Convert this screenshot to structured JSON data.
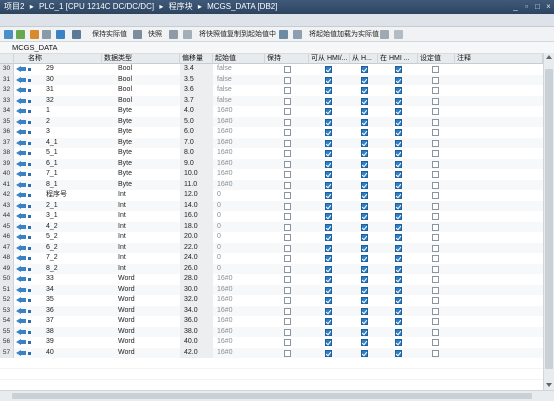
{
  "breadcrumb": [
    "项目2",
    "PLC_1 [CPU 1214C DC/DC/DC]",
    "程序块",
    "MCGS_DATA [DB2]"
  ],
  "breadcrumb_separator": "▸",
  "window_controls": [
    "_",
    "▫",
    "□",
    "×"
  ],
  "toolbar": {
    "keep_actual": "保持实际值",
    "snapshot": "快照",
    "copy_snapshot": "将快照值复制到起始值中",
    "load_start": "将起始值加载为实际值"
  },
  "block_name": "MCGS_DATA",
  "columns": [
    "名称",
    "数据类型",
    "偏移量",
    "起始值",
    "保持",
    "可从 HMI/...",
    "从 H...",
    "在 HMI ...",
    "设定值",
    "注释"
  ],
  "rows": [
    {
      "n": "30",
      "name": "29",
      "type": "Bool",
      "offset": "3.4",
      "start": "false",
      "hmi1": true,
      "hmi2": true,
      "hmi3": true
    },
    {
      "n": "31",
      "name": "30",
      "type": "Bool",
      "offset": "3.5",
      "start": "false",
      "hmi1": true,
      "hmi2": true,
      "hmi3": true
    },
    {
      "n": "32",
      "name": "31",
      "type": "Bool",
      "offset": "3.6",
      "start": "false",
      "hmi1": true,
      "hmi2": true,
      "hmi3": true
    },
    {
      "n": "33",
      "name": "32",
      "type": "Bool",
      "offset": "3.7",
      "start": "false",
      "hmi1": true,
      "hmi2": true,
      "hmi3": true
    },
    {
      "n": "34",
      "name": "1",
      "type": "Byte",
      "offset": "4.0",
      "start": "16#0",
      "hmi1": true,
      "hmi2": true,
      "hmi3": true
    },
    {
      "n": "35",
      "name": "2",
      "type": "Byte",
      "offset": "5.0",
      "start": "16#0",
      "hmi1": true,
      "hmi2": true,
      "hmi3": true
    },
    {
      "n": "36",
      "name": "3",
      "type": "Byte",
      "offset": "6.0",
      "start": "16#0",
      "hmi1": true,
      "hmi2": true,
      "hmi3": true
    },
    {
      "n": "37",
      "name": "4_1",
      "type": "Byte",
      "offset": "7.0",
      "start": "16#0",
      "hmi1": true,
      "hmi2": true,
      "hmi3": true
    },
    {
      "n": "38",
      "name": "5_1",
      "type": "Byte",
      "offset": "8.0",
      "start": "16#0",
      "hmi1": true,
      "hmi2": true,
      "hmi3": true
    },
    {
      "n": "39",
      "name": "6_1",
      "type": "Byte",
      "offset": "9.0",
      "start": "16#0",
      "hmi1": true,
      "hmi2": true,
      "hmi3": true
    },
    {
      "n": "40",
      "name": "7_1",
      "type": "Byte",
      "offset": "10.0",
      "start": "16#0",
      "hmi1": true,
      "hmi2": true,
      "hmi3": true
    },
    {
      "n": "41",
      "name": "8_1",
      "type": "Byte",
      "offset": "11.0",
      "start": "16#0",
      "hmi1": true,
      "hmi2": true,
      "hmi3": true
    },
    {
      "n": "42",
      "name": "程序号",
      "type": "Int",
      "offset": "12.0",
      "start": "0",
      "hmi1": true,
      "hmi2": true,
      "hmi3": true
    },
    {
      "n": "43",
      "name": "2_1",
      "type": "Int",
      "offset": "14.0",
      "start": "0",
      "hmi1": true,
      "hmi2": true,
      "hmi3": true
    },
    {
      "n": "44",
      "name": "3_1",
      "type": "Int",
      "offset": "16.0",
      "start": "0",
      "hmi1": true,
      "hmi2": true,
      "hmi3": true
    },
    {
      "n": "45",
      "name": "4_2",
      "type": "Int",
      "offset": "18.0",
      "start": "0",
      "hmi1": true,
      "hmi2": true,
      "hmi3": true
    },
    {
      "n": "46",
      "name": "5_2",
      "type": "Int",
      "offset": "20.0",
      "start": "0",
      "hmi1": true,
      "hmi2": true,
      "hmi3": true
    },
    {
      "n": "47",
      "name": "6_2",
      "type": "Int",
      "offset": "22.0",
      "start": "0",
      "hmi1": true,
      "hmi2": true,
      "hmi3": true
    },
    {
      "n": "48",
      "name": "7_2",
      "type": "Int",
      "offset": "24.0",
      "start": "0",
      "hmi1": true,
      "hmi2": true,
      "hmi3": true
    },
    {
      "n": "49",
      "name": "8_2",
      "type": "Int",
      "offset": "26.0",
      "start": "0",
      "hmi1": true,
      "hmi2": true,
      "hmi3": true
    },
    {
      "n": "50",
      "name": "33",
      "type": "Word",
      "offset": "28.0",
      "start": "16#0",
      "hmi1": true,
      "hmi2": true,
      "hmi3": true
    },
    {
      "n": "51",
      "name": "34",
      "type": "Word",
      "offset": "30.0",
      "start": "16#0",
      "hmi1": true,
      "hmi2": true,
      "hmi3": true
    },
    {
      "n": "52",
      "name": "35",
      "type": "Word",
      "offset": "32.0",
      "start": "16#0",
      "hmi1": true,
      "hmi2": true,
      "hmi3": true
    },
    {
      "n": "53",
      "name": "36",
      "type": "Word",
      "offset": "34.0",
      "start": "16#0",
      "hmi1": true,
      "hmi2": true,
      "hmi3": true
    },
    {
      "n": "54",
      "name": "37",
      "type": "Word",
      "offset": "36.0",
      "start": "16#0",
      "hmi1": true,
      "hmi2": true,
      "hmi3": true
    },
    {
      "n": "55",
      "name": "38",
      "type": "Word",
      "offset": "38.0",
      "start": "16#0",
      "hmi1": true,
      "hmi2": true,
      "hmi3": true
    },
    {
      "n": "56",
      "name": "39",
      "type": "Word",
      "offset": "40.0",
      "start": "16#0",
      "hmi1": true,
      "hmi2": true,
      "hmi3": true
    },
    {
      "n": "57",
      "name": "40",
      "type": "Word",
      "offset": "42.0",
      "start": "16#0",
      "hmi1": true,
      "hmi2": true,
      "hmi3": true
    }
  ],
  "colors": {
    "checkbox_checked": "#2e7fc6",
    "title_bar": "#2c4460"
  }
}
